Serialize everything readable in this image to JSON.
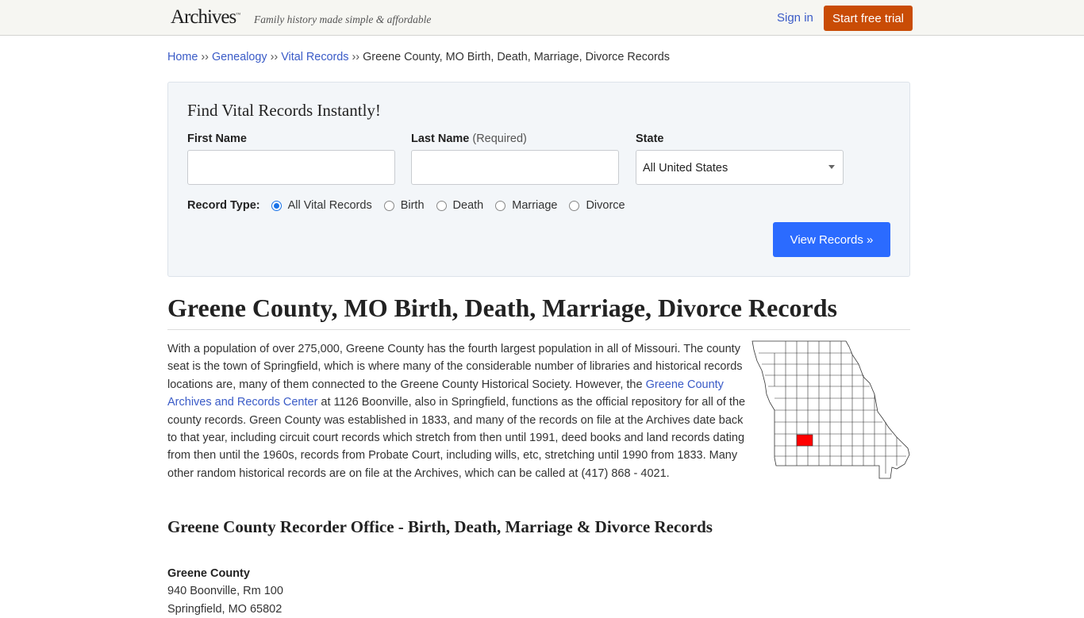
{
  "header": {
    "logo": "Archives",
    "logo_tm": "™",
    "tagline": "Family history made simple & affordable",
    "sign_in": "Sign in",
    "trial_button": "Start free trial",
    "trial_color": "#c94c06"
  },
  "breadcrumb": {
    "items": [
      "Home",
      "Genealogy",
      "Vital Records"
    ],
    "separator": "››",
    "current": "Greene County, MO Birth, Death, Marriage, Divorce Records"
  },
  "search": {
    "title": "Find Vital Records Instantly!",
    "first_name_label": "First Name",
    "first_name_value": "",
    "last_name_label": "Last Name",
    "last_name_required": "(Required)",
    "last_name_value": "",
    "state_label": "State",
    "state_value": "All United States",
    "record_type_label": "Record Type:",
    "record_types": [
      {
        "label": "All Vital Records",
        "checked": true
      },
      {
        "label": "Birth",
        "checked": false
      },
      {
        "label": "Death",
        "checked": false
      },
      {
        "label": "Marriage",
        "checked": false
      },
      {
        "label": "Divorce",
        "checked": false
      }
    ],
    "submit": "View Records »",
    "submit_color": "#2b6bff"
  },
  "main": {
    "title": "Greene County, MO Birth, Death, Marriage, Divorce Records",
    "intro_part1": "With a population of over 275,000, Greene County has the fourth largest population in all of Missouri. The county seat is the town of Springfield, which is where many of the considerable number of libraries and historical records locations are, many of them connected to the Greene County Historical Society. However, the ",
    "intro_link": "Greene County Archives and Records Center",
    "intro_part2": " at 1126 Boonville, also in Springfield, functions as the official repository for all of the county records. Green County was established in 1833, and many of the records on file at the Archives date back to that year, including circuit court records which stretch from then until 1991, deed books and land records dating from then until the 1960s, records from Probate Court, including wills, etc, stretching until 1990 from 1833. Many other random historical records are on file at the Archives, which can be called at (417) 868 - 4021.",
    "map_highlight_color": "#ff0000",
    "map_label": "Missouri county map with Greene County highlighted",
    "section_title": "Greene County Recorder Office - Birth, Death, Marriage & Divorce Records",
    "office": {
      "name": "Greene County",
      "address1": "940 Boonville, Rm 100",
      "address2": "Springfield, MO 65802"
    }
  }
}
